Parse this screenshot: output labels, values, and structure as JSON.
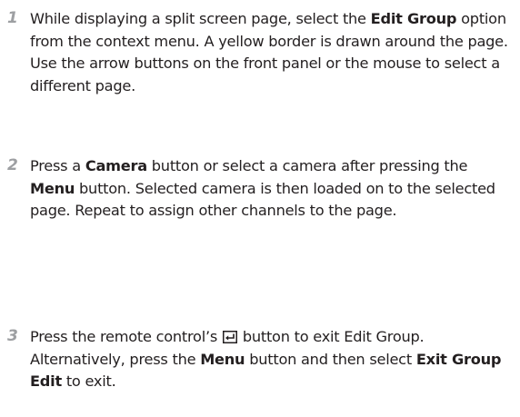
{
  "steps": [
    {
      "number": "1",
      "parts": [
        {
          "text": "While displaying a split screen page, select the "
        },
        {
          "text": "Edit Group",
          "bold": true
        },
        {
          "text": " option from the context menu. A yellow border is drawn around the page. Use the arrow buttons on the front panel or the mouse to select a different page."
        }
      ]
    },
    {
      "number": "2",
      "parts": [
        {
          "text": "Press a "
        },
        {
          "text": "Camera",
          "bold": true
        },
        {
          "text": " button or select a camera after pressing the "
        },
        {
          "text": "Menu",
          "bold": true
        },
        {
          "text": " button. Selected camera is then loaded on to the selected page. Repeat to assign other channels to the page."
        }
      ]
    },
    {
      "number": "3",
      "parts": [
        {
          "text": "Press the remote control’s "
        },
        {
          "icon": "enter-key-icon"
        },
        {
          "text": " button to exit Edit Group. Alternatively, press the "
        },
        {
          "text": "Menu",
          "bold": true
        },
        {
          "text": " button and then select "
        },
        {
          "text": "Exit Group Edit",
          "bold": true
        },
        {
          "text": " to exit."
        }
      ]
    }
  ]
}
